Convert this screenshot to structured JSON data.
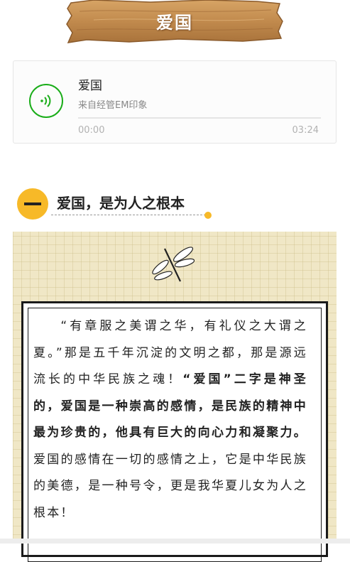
{
  "banner": {
    "title": "爱国"
  },
  "audio": {
    "title": "爱国",
    "source": "来自经管EM印象",
    "current_time": "00:00",
    "duration": "03:24",
    "progress": 0
  },
  "section": {
    "title": "爱国，是为人之根本"
  },
  "article": {
    "p1_part1": "“有章服之美谓之华，有礼仪之大谓之夏。”那是五千年沉淀的文明之都，那是源远流长的中华民族之魂！",
    "p1_bold": "“爱国”二字是神圣的，爱国是一种崇高的感情，是民族的精神中最为珍贵的，他具有巨大的向心力和凝聚力。",
    "p1_part2": "爱国的感情在一切的感情之上，它是中华民族的美德，是一种号令，更是我华夏儿女为人之根本！"
  },
  "colors": {
    "accent_green": "#1aad19",
    "badge_yellow": "#f7b928",
    "panel_bg": "#f0e7c6"
  },
  "icons": {
    "play": "audio-play-icon",
    "decor": "dragonfly-icon"
  }
}
